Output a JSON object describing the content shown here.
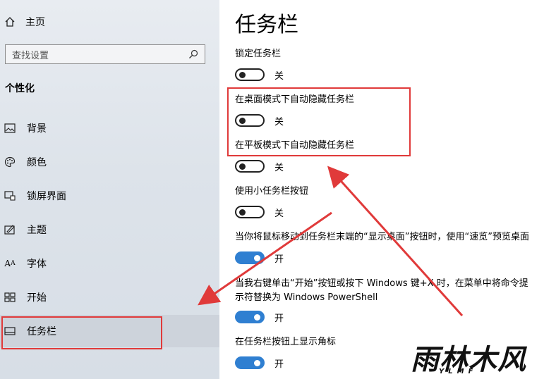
{
  "sidebar": {
    "home_label": "主页",
    "search_placeholder": "查找设置",
    "section_title": "个性化",
    "items": [
      {
        "label": "背景",
        "icon": "picture-icon"
      },
      {
        "label": "颜色",
        "icon": "palette-icon"
      },
      {
        "label": "锁屏界面",
        "icon": "lock-screen-icon"
      },
      {
        "label": "主题",
        "icon": "theme-icon"
      },
      {
        "label": "字体",
        "icon": "font-icon"
      },
      {
        "label": "开始",
        "icon": "start-icon"
      },
      {
        "label": "任务栏",
        "icon": "taskbar-icon"
      }
    ]
  },
  "main": {
    "title": "任务栏",
    "settings": [
      {
        "label": "锁定任务栏",
        "state": "关",
        "on": false
      },
      {
        "label": "在桌面模式下自动隐藏任务栏",
        "state": "关",
        "on": false
      },
      {
        "label": "在平板模式下自动隐藏任务栏",
        "state": "关",
        "on": false
      },
      {
        "label": "使用小任务栏按钮",
        "state": "关",
        "on": false
      },
      {
        "label": "当你将鼠标移动到任务栏末端的“显示桌面”按钮时，使用“速览”预览桌面",
        "state": "开",
        "on": true
      },
      {
        "label_line1": "当我右键单击“开始”按钮或按下 Windows 键+X 时，在菜单中将命令提",
        "label_line2": "示符替换为 Windows PowerShell",
        "state": "开",
        "on": true
      },
      {
        "label": "在任务栏按钮上显示角标",
        "state": "开",
        "on": true
      }
    ]
  },
  "watermark": {
    "main": "雨林木风",
    "sub": "YLMF"
  },
  "colors": {
    "annotation": "#e03a3a",
    "toggle_on": "#2f7fd1"
  }
}
